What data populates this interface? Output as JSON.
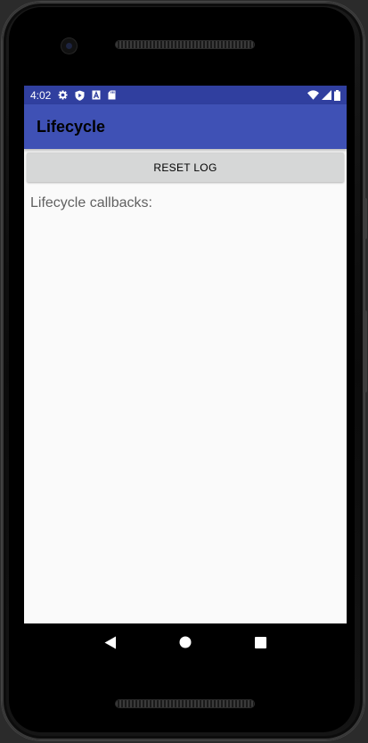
{
  "status_bar": {
    "time": "4:02",
    "left_icons": [
      "settings-icon",
      "play-protect-icon",
      "a-letter-icon",
      "sd-card-icon"
    ],
    "right_icons": [
      "wifi-icon",
      "signal-icon",
      "battery-icon"
    ]
  },
  "app_bar": {
    "title": "Lifecycle"
  },
  "main": {
    "reset_button_label": "RESET LOG",
    "log_label": "Lifecycle callbacks:"
  },
  "nav_bar": {
    "buttons": [
      "back-icon",
      "home-icon",
      "recents-icon"
    ]
  },
  "colors": {
    "status_bar": "#303f9f",
    "app_bar": "#3f51b5",
    "button": "#d6d7d7",
    "background": "#fafafa"
  }
}
